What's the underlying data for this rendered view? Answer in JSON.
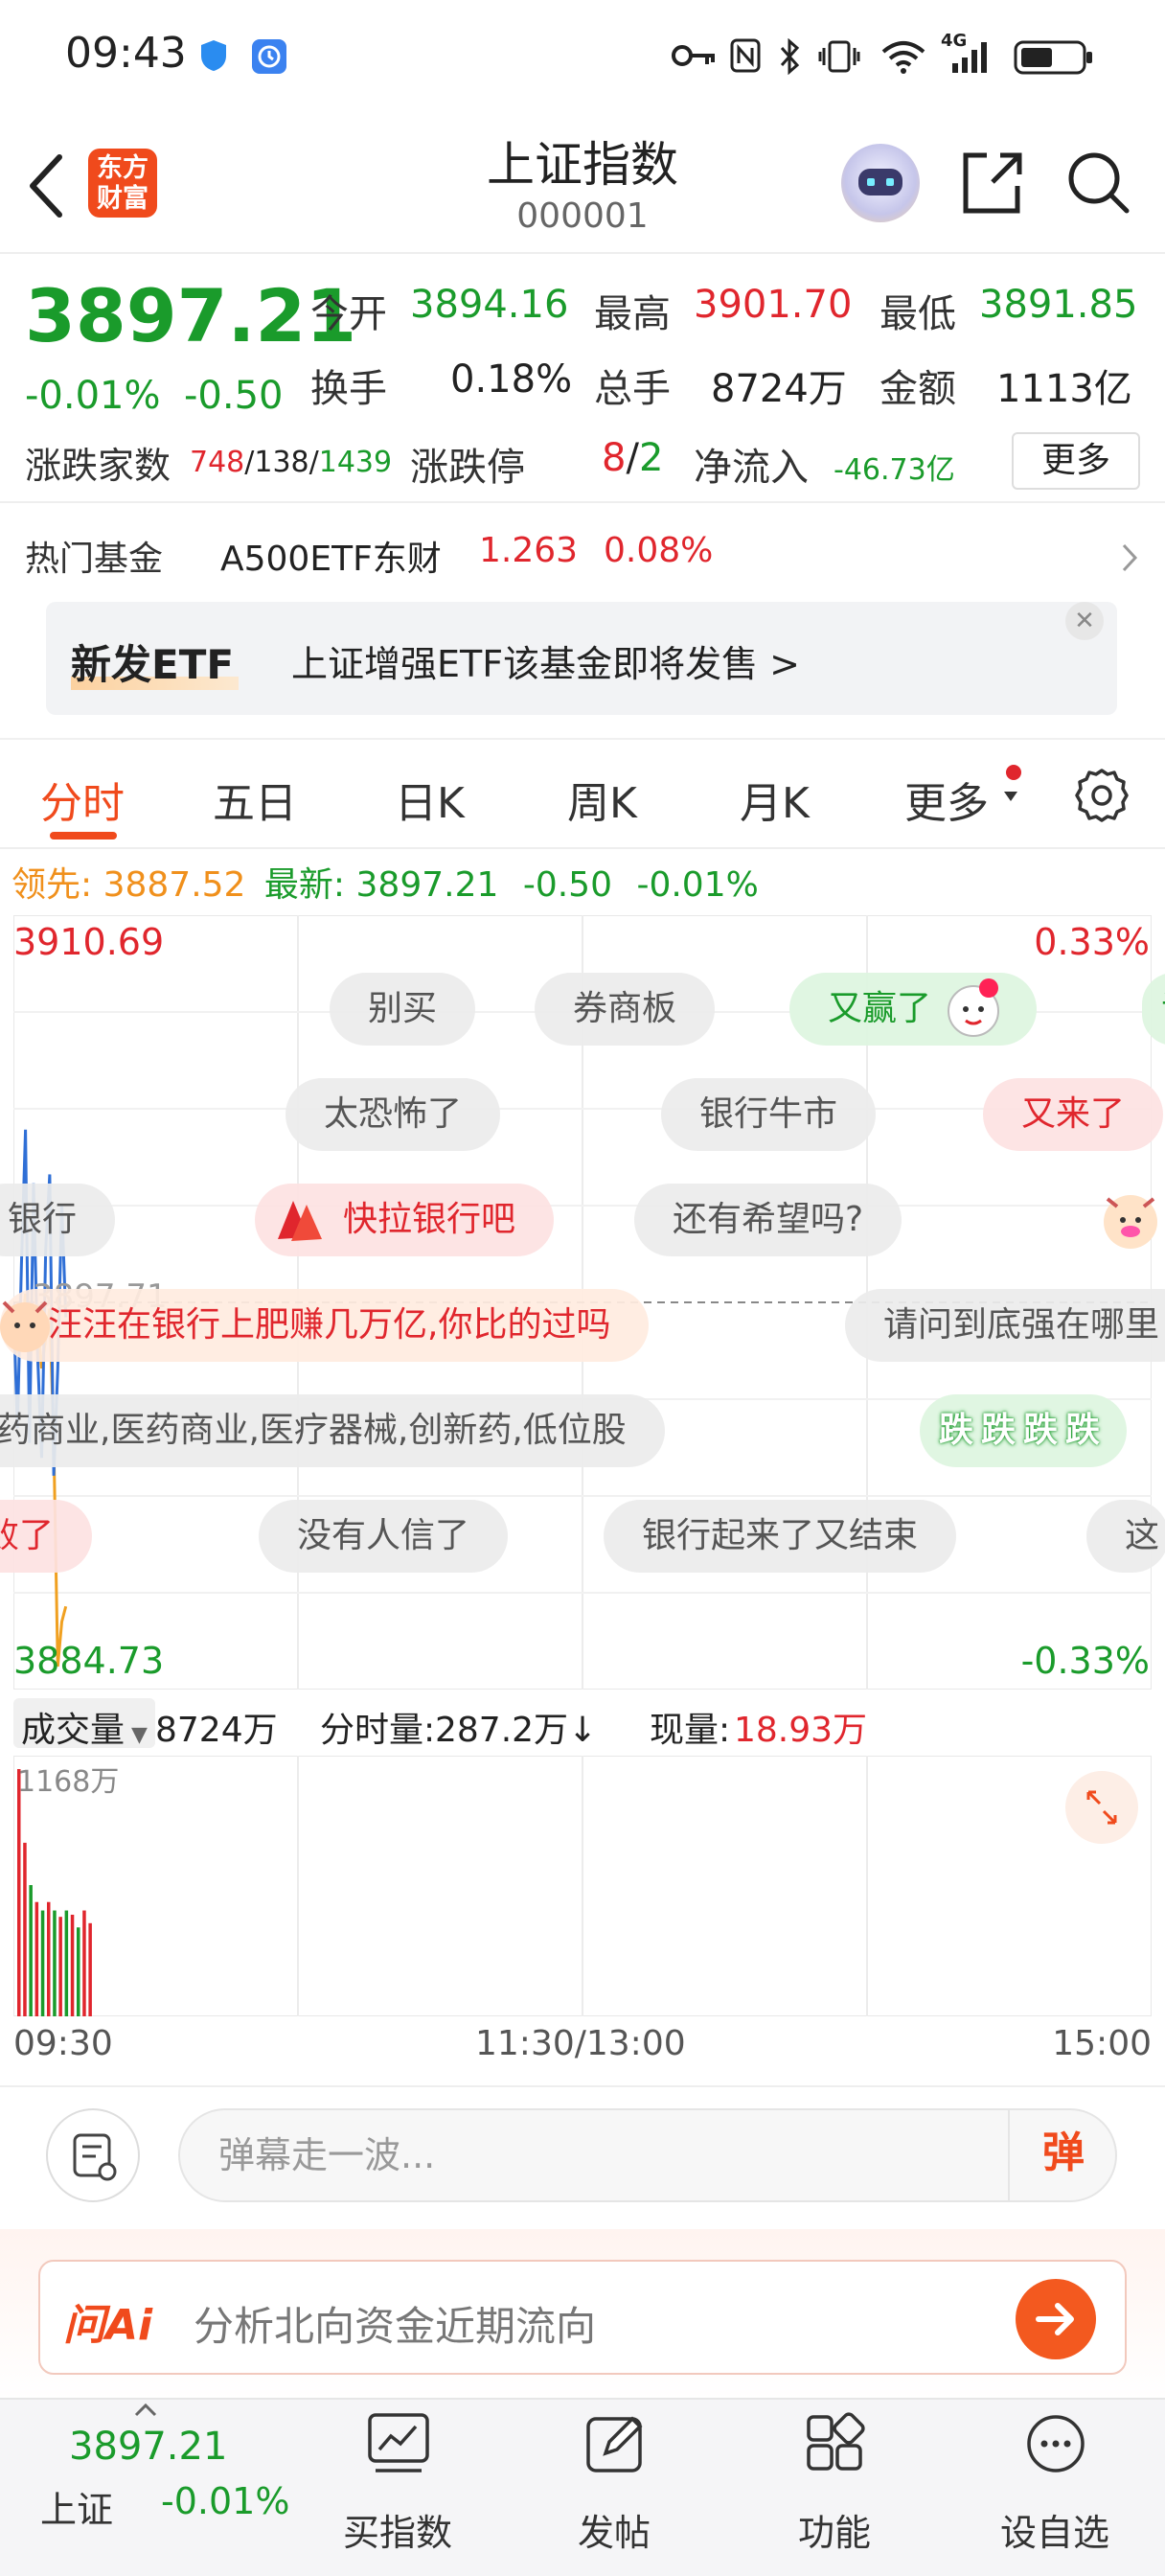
{
  "status_bar": {
    "time": "09:43",
    "network": "4G"
  },
  "header": {
    "title": "上证指数",
    "code": "000001",
    "logo_text_line1": "东方",
    "logo_text_line2": "财富"
  },
  "quote": {
    "price": "3897.21",
    "pct_change": "-0.01%",
    "abs_change": "-0.50",
    "open_label": "今开",
    "open": "3894.16",
    "high_label": "最高",
    "high": "3901.70",
    "low_label": "最低",
    "low": "3891.85",
    "turnover_label": "换手",
    "turnover": "0.18%",
    "volume_label": "总手",
    "volume": "8724万",
    "amount_label": "金额",
    "amount": "1113亿",
    "breadth_label": "涨跌家数",
    "breadth_up": "748",
    "breadth_flat": "/138/",
    "breadth_down": "1439",
    "limit_label": "涨跌停",
    "limit_up": "8",
    "limit_sep": "/",
    "limit_down": "2",
    "inflow_label": "净流入",
    "inflow": "-46.73亿",
    "more_button": "更多"
  },
  "hot_fund": {
    "label": "热门基金",
    "name": "A500ETF东财",
    "price": "1.263",
    "pct": "0.08%"
  },
  "etf_banner": {
    "tag": "新发ETF",
    "text": "上证增强ETF该基金即将发售  >"
  },
  "tabs": [
    {
      "label": "分时",
      "active": true
    },
    {
      "label": "五日"
    },
    {
      "label": "日K"
    },
    {
      "label": "周K"
    },
    {
      "label": "月K"
    },
    {
      "label": "更多"
    }
  ],
  "chart_info": {
    "lead_label": "领先:",
    "lead_value": "3887.52",
    "latest_label": "最新:",
    "latest_value": "3897.21",
    "abs_change": "-0.50",
    "pct_change": "-0.01%"
  },
  "chart_labels": {
    "y_top": "3910.69",
    "y_top_pct": "0.33%",
    "y_bottom": "3884.73",
    "y_bottom_pct": "-0.33%",
    "prev_close": "3897.71"
  },
  "chart_data": {
    "type": "line",
    "ylim": [
      3884.73,
      3910.69
    ],
    "prev_close": 3897.71,
    "x": [
      "09:30",
      "09:31",
      "09:32",
      "09:33",
      "09:34",
      "09:35",
      "09:36",
      "09:37",
      "09:38",
      "09:39",
      "09:40",
      "09:41",
      "09:42",
      "09:43"
    ],
    "series": [
      {
        "values": [
          3897.7,
          3893.5,
          3899.0,
          3903.5,
          3893.0,
          3901.7,
          3896.0,
          3892.5,
          3899.5,
          3902.0,
          3891.9,
          3895.5,
          3901.0,
          3897.21
        ]
      },
      {
        "values": [
          3897.7,
          3896.0,
          3896.5,
          3898.0,
          3896.5,
          3897.5,
          3897.0,
          3895.5,
          3896.5,
          3897.5,
          3893.0,
          3885.5,
          3887.0,
          3887.52
        ]
      }
    ],
    "time_axis": [
      "09:30",
      "11:30/13:00",
      "15:00"
    ],
    "volume": {
      "max_label": "1168万",
      "values": [
        1168,
        820,
        620,
        540,
        500,
        540,
        500,
        470,
        500,
        480,
        420,
        500,
        440
      ],
      "colors": [
        "red",
        "red",
        "green",
        "red",
        "green",
        "red",
        "green",
        "red",
        "green",
        "red",
        "green",
        "red",
        "red"
      ]
    }
  },
  "danmaku": [
    {
      "text": "别买",
      "style": "gray"
    },
    {
      "text": "券商板",
      "style": "gray"
    },
    {
      "text": "又赢了",
      "style": "greenb"
    },
    {
      "text": "证",
      "style": "greenb"
    },
    {
      "text": "太恐怖了",
      "style": "gray"
    },
    {
      "text": "银行牛市",
      "style": "gray"
    },
    {
      "text": "又来了",
      "style": "pink"
    },
    {
      "text": "银行",
      "style": "gray"
    },
    {
      "text": "快拉银行吧",
      "style": "pink"
    },
    {
      "text": "还有希望吗?",
      "style": "gray"
    },
    {
      "text": "汪汪在银行上肥赚几万亿,你比的过吗",
      "style": "peach"
    },
    {
      "text": "请问到底强在哪里",
      "style": "gray"
    },
    {
      "text": "药商业,医药商业,医疗器械,创新药,低位股",
      "style": "gray"
    },
    {
      "text": "跌跌跌跌",
      "style": "greenb"
    },
    {
      "text": "败了",
      "style": "pink"
    },
    {
      "text": "没有人信了",
      "style": "gray"
    },
    {
      "text": "银行起来了又结束",
      "style": "gray"
    },
    {
      "text": "这",
      "style": "gray"
    }
  ],
  "volume_row": {
    "label": "成交量",
    "total": "8724万",
    "minute_label": "分时量:",
    "minute_value": "287.2万↓",
    "current_label": "现量:",
    "current_value": "18.93万"
  },
  "comment": {
    "placeholder": "弹幕走一波...",
    "toggle": "弹"
  },
  "ai": {
    "logo": "问Ai",
    "text": "分析北向资金近期流向"
  },
  "bottom_nav": {
    "index_price": "3897.21",
    "index_name": "上证",
    "index_pct": "-0.01%",
    "items": [
      {
        "label": "买指数"
      },
      {
        "label": "发帖"
      },
      {
        "label": "功能"
      },
      {
        "label": "设自选"
      }
    ]
  },
  "colors": {
    "up": "#e0262d",
    "down": "#1a9b2b",
    "accent": "#f04a1c",
    "lead_line": "#f0a020",
    "price_line": "#2f6fd6"
  }
}
